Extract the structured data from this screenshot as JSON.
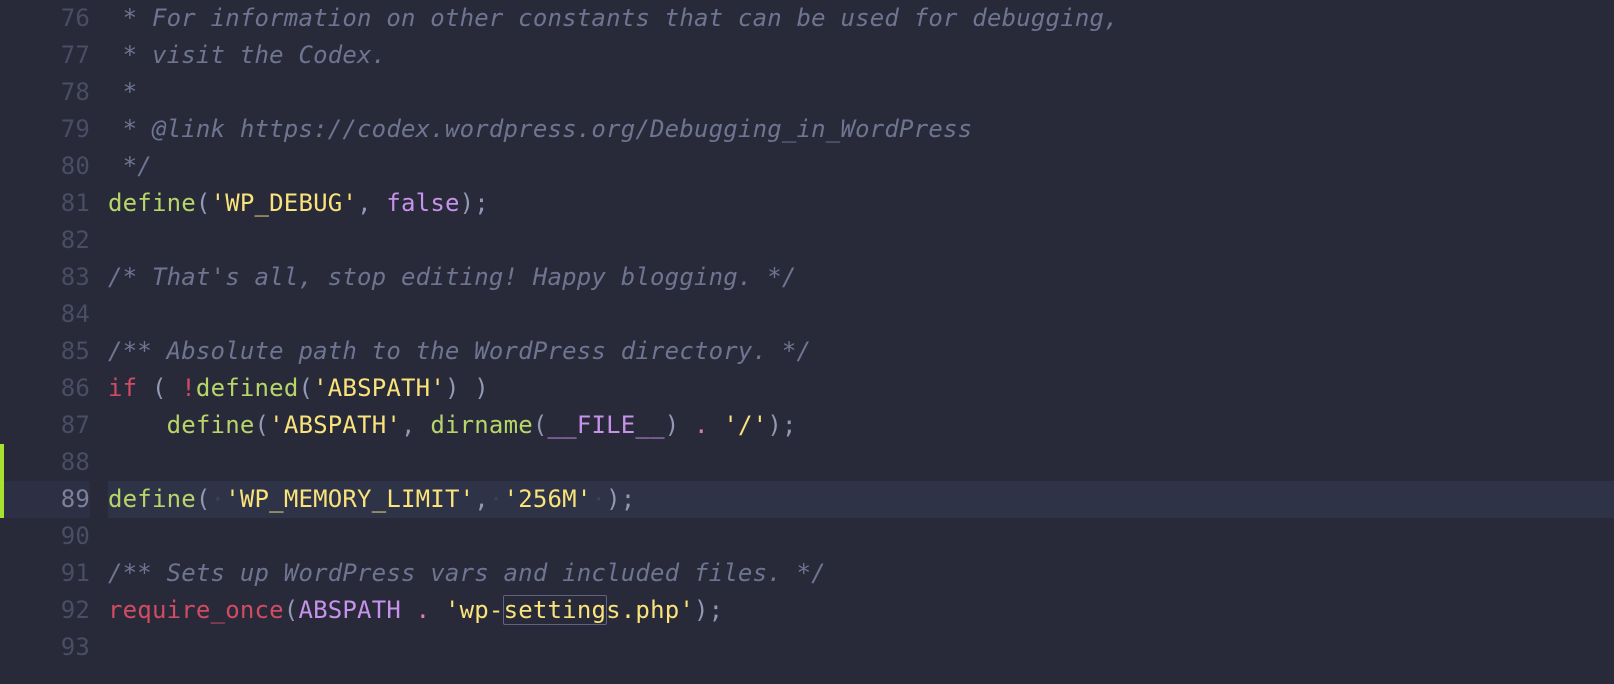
{
  "first_line_number": 76,
  "current_line_number": 89,
  "change_bar_lines": [
    88,
    89
  ],
  "search_highlight": "setting",
  "lines": [
    {
      "n": 76,
      "tokens": [
        {
          "cls": "cm",
          "t": " * For information on other constants that can be used for debugging,"
        }
      ]
    },
    {
      "n": 77,
      "tokens": [
        {
          "cls": "cm",
          "t": " * visit the Codex."
        }
      ]
    },
    {
      "n": 78,
      "tokens": [
        {
          "cls": "cm",
          "t": " *"
        }
      ]
    },
    {
      "n": 79,
      "tokens": [
        {
          "cls": "cm",
          "t": " * @link https://codex.wordpress.org/Debugging_in_WordPress"
        }
      ]
    },
    {
      "n": 80,
      "tokens": [
        {
          "cls": "cm",
          "t": " */"
        }
      ]
    },
    {
      "n": 81,
      "tokens": [
        {
          "cls": "fn",
          "t": "define"
        },
        {
          "cls": "pun",
          "t": "("
        },
        {
          "cls": "str",
          "t": "'WP_DEBUG'"
        },
        {
          "cls": "pun",
          "t": ", "
        },
        {
          "cls": "bool",
          "t": "false"
        },
        {
          "cls": "pun",
          "t": ");"
        }
      ]
    },
    {
      "n": 82,
      "tokens": []
    },
    {
      "n": 83,
      "tokens": [
        {
          "cls": "cm",
          "t": "/* That's all, stop editing! Happy blogging. */"
        }
      ]
    },
    {
      "n": 84,
      "tokens": []
    },
    {
      "n": 85,
      "tokens": [
        {
          "cls": "cm",
          "t": "/** Absolute path to the WordPress directory. */"
        }
      ]
    },
    {
      "n": 86,
      "tokens": [
        {
          "cls": "kw",
          "t": "if"
        },
        {
          "cls": "pun",
          "t": " ( "
        },
        {
          "cls": "kw",
          "t": "!"
        },
        {
          "cls": "fn",
          "t": "defined"
        },
        {
          "cls": "pun",
          "t": "("
        },
        {
          "cls": "str",
          "t": "'ABSPATH'"
        },
        {
          "cls": "pun",
          "t": ") )"
        }
      ]
    },
    {
      "n": 87,
      "tokens": [
        {
          "cls": "pun",
          "t": "    "
        },
        {
          "cls": "fn",
          "t": "define"
        },
        {
          "cls": "pun",
          "t": "("
        },
        {
          "cls": "str",
          "t": "'ABSPATH'"
        },
        {
          "cls": "pun",
          "t": ", "
        },
        {
          "cls": "fn",
          "t": "dirname"
        },
        {
          "cls": "pun",
          "t": "("
        },
        {
          "cls": "mag",
          "t": "__FILE__"
        },
        {
          "cls": "pun",
          "t": ") "
        },
        {
          "cls": "op",
          "t": "."
        },
        {
          "cls": "pun",
          "t": " "
        },
        {
          "cls": "str",
          "t": "'/'"
        },
        {
          "cls": "pun",
          "t": ");"
        }
      ]
    },
    {
      "n": 88,
      "tokens": []
    },
    {
      "n": 89,
      "hl": true,
      "tokens": [
        {
          "cls": "fn",
          "t": "define"
        },
        {
          "cls": "pun",
          "t": "("
        },
        {
          "cls": "wsdot",
          "t": "·"
        },
        {
          "cls": "str",
          "t": "'WP_MEMORY_LIMIT'"
        },
        {
          "cls": "pun",
          "t": ","
        },
        {
          "cls": "wsdot",
          "t": "·"
        },
        {
          "cls": "str",
          "t": "'256M'"
        },
        {
          "cls": "wsdot",
          "t": "·"
        },
        {
          "cls": "pun",
          "t": ");"
        }
      ]
    },
    {
      "n": 90,
      "tokens": []
    },
    {
      "n": 91,
      "tokens": [
        {
          "cls": "cm",
          "t": "/** Sets up WordPress vars and included files. */"
        }
      ]
    },
    {
      "n": 92,
      "tokens": [
        {
          "cls": "kw",
          "t": "require_once"
        },
        {
          "cls": "pun",
          "t": "("
        },
        {
          "cls": "mag",
          "t": "ABSPATH"
        },
        {
          "cls": "pun",
          "t": " "
        },
        {
          "cls": "op",
          "t": "."
        },
        {
          "cls": "pun",
          "t": " "
        },
        {
          "cls": "str",
          "t": "'wp-"
        },
        {
          "cls": "str selbox",
          "t": "setting"
        },
        {
          "cls": "str",
          "t": "s.php'"
        },
        {
          "cls": "pun",
          "t": ");"
        }
      ]
    },
    {
      "n": 93,
      "tokens": []
    }
  ]
}
